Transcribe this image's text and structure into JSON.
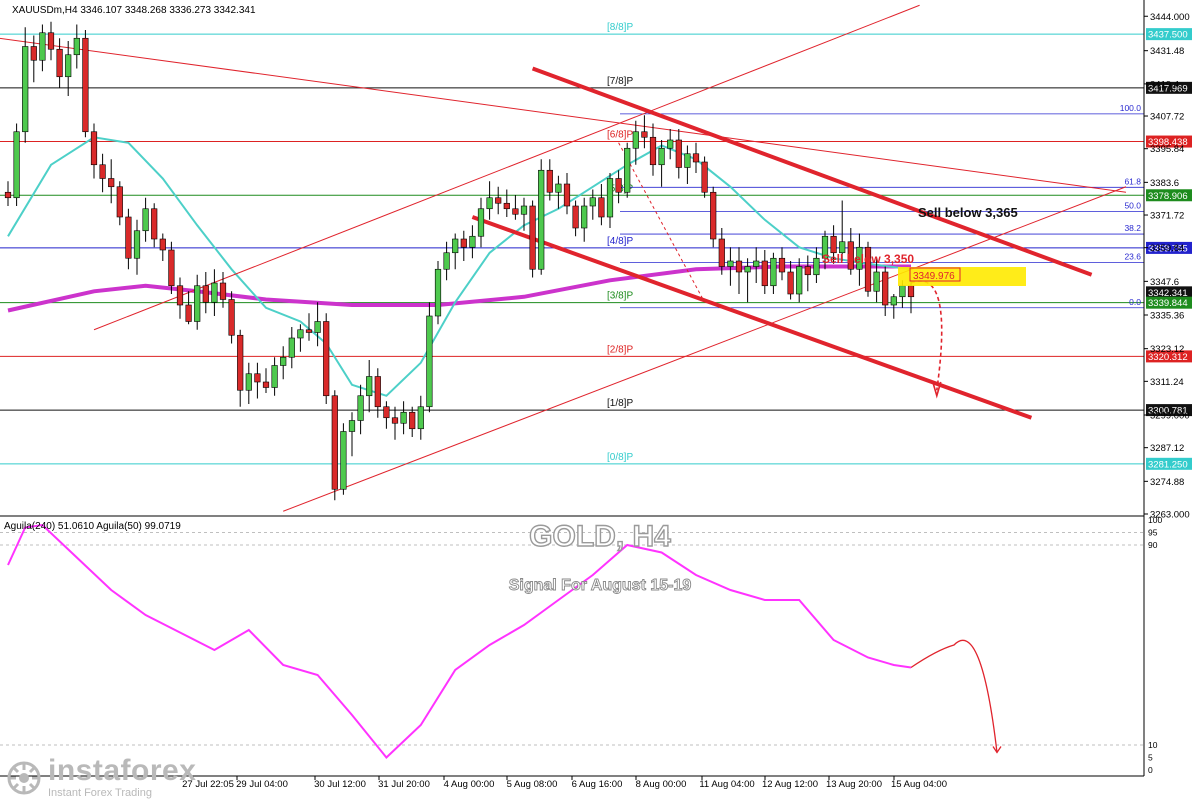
{
  "header": {
    "symbol_text": "XAUUSDm,H4  3346.107 3348.268 3336.273 3342.341",
    "osc_text": "Aguila(240) 51.0610  Aguila(50) 99.0719"
  },
  "overlay": {
    "title": "GOLD, H4",
    "subtitle": "Signal For August 15-19",
    "sell1": "Sell below 3,365",
    "sell2": "Sell below 3,350",
    "price_box": "3349.976"
  },
  "murrey": [
    {
      "name": "[8/8]P",
      "price": 3437.5,
      "color": "#33cccc"
    },
    {
      "name": "[7/8]P",
      "price": 3417.969,
      "color": "#111111"
    },
    {
      "name": "[6/8]P",
      "price": 3398.438,
      "color": "#dd2222"
    },
    {
      "name": "[5/8]P",
      "price": 3378.906,
      "color": "#1e8c1e"
    },
    {
      "name": "[4/8]P",
      "price": 3359.765,
      "color": "#2222cc"
    },
    {
      "name": "[3/8]P",
      "price": 3339.844,
      "color": "#1e8c1e"
    },
    {
      "name": "[2/8]P",
      "price": 3320.312,
      "color": "#dd2222"
    },
    {
      "name": "[1/8]P",
      "price": 3300.781,
      "color": "#111111"
    },
    {
      "name": "[0/8]P",
      "price": 3281.25,
      "color": "#33cccc"
    }
  ],
  "fib": [
    {
      "label": "100.0",
      "price": 3408.5
    },
    {
      "label": "61.8",
      "price": 3381.8
    },
    {
      "label": "50.0",
      "price": 3373.0
    },
    {
      "label": "38.2",
      "price": 3364.8
    },
    {
      "label": "23.6",
      "price": 3354.5
    },
    {
      "label": "0.0",
      "price": 3338.0
    }
  ],
  "price_boxes": [
    {
      "text": "3437.500",
      "price": 3437.5,
      "bg": "#33cccc",
      "fg": "#ffffff"
    },
    {
      "text": "3417.969",
      "price": 3417.969,
      "bg": "#111111",
      "fg": "#ffffff"
    },
    {
      "text": "3398.438",
      "price": 3398.438,
      "bg": "#dd2222",
      "fg": "#ffffff"
    },
    {
      "text": "3378.906",
      "price": 3378.906,
      "bg": "#1e8c1e",
      "fg": "#ffffff"
    },
    {
      "text": "3359.765",
      "price": 3359.765,
      "bg": "#2222cc",
      "fg": "#ffffff"
    },
    {
      "text": "3342.341",
      "price": 3343.6,
      "bg": "#111111",
      "fg": "#ffffff"
    },
    {
      "text": "3339.844",
      "price": 3339.844,
      "bg": "#1e8c1e",
      "fg": "#ffffff"
    },
    {
      "text": "3320.312",
      "price": 3320.312,
      "bg": "#dd2222",
      "fg": "#ffffff"
    },
    {
      "text": "3300.781",
      "price": 3300.781,
      "bg": "#111111",
      "fg": "#ffffff"
    },
    {
      "text": "3281.250",
      "price": 3281.25,
      "bg": "#33cccc",
      "fg": "#ffffff"
    }
  ],
  "chart_data": {
    "type": "candlestick",
    "title": "GOLD, H4",
    "subtitle": "Signal For August 15-19",
    "symbol": "XAUUSDm",
    "timeframe": "H4",
    "ohlc_last": {
      "open": 3346.107,
      "high": 3348.268,
      "low": 3336.273,
      "close": 3342.341
    },
    "y_ticks": [
      3444.0,
      3431.48,
      3419.4,
      3407.72,
      3395.84,
      3383.6,
      3371.72,
      3359.84,
      3347.6,
      3335.36,
      3323.12,
      3311.24,
      3299.0,
      3287.12,
      3274.88,
      3263.0
    ],
    "ylim": [
      3263.0,
      3447.0
    ],
    "x_ticks": [
      "27 Jul 22:05",
      "29 Jul 04:00",
      "30 Jul 12:00",
      "31 Jul 20:00",
      "4 Aug 00:00",
      "5 Aug 08:00",
      "6 Aug 16:00",
      "8 Aug 00:00",
      "11 Aug 04:00",
      "12 Aug 12:00",
      "13 Aug 20:00",
      "15 Aug 04:00"
    ],
    "candles": [
      [
        3380,
        3384,
        3375,
        3378
      ],
      [
        3378,
        3405,
        3375,
        3402
      ],
      [
        3402,
        3440,
        3398,
        3433
      ],
      [
        3433,
        3437,
        3420,
        3428
      ],
      [
        3428,
        3441,
        3424,
        3438
      ],
      [
        3438,
        3442,
        3428,
        3432
      ],
      [
        3432,
        3436,
        3418,
        3422
      ],
      [
        3422,
        3435,
        3415,
        3430
      ],
      [
        3430,
        3441,
        3425,
        3436
      ],
      [
        3436,
        3439,
        3400,
        3402
      ],
      [
        3402,
        3405,
        3385,
        3390
      ],
      [
        3390,
        3394,
        3380,
        3385
      ],
      [
        3385,
        3392,
        3376,
        3382
      ],
      [
        3382,
        3384,
        3368,
        3371
      ],
      [
        3371,
        3374,
        3352,
        3356
      ],
      [
        3356,
        3370,
        3350,
        3366
      ],
      [
        3366,
        3378,
        3362,
        3374
      ],
      [
        3374,
        3376,
        3360,
        3363
      ],
      [
        3363,
        3365,
        3355,
        3359
      ],
      [
        3359,
        3362,
        3343,
        3346
      ],
      [
        3346,
        3349,
        3334,
        3339
      ],
      [
        3339,
        3344,
        3332,
        3333
      ],
      [
        3333,
        3350,
        3330,
        3346
      ],
      [
        3346,
        3351,
        3336,
        3340
      ],
      [
        3340,
        3352,
        3335,
        3347
      ],
      [
        3347,
        3351,
        3338,
        3341
      ],
      [
        3341,
        3344,
        3325,
        3328
      ],
      [
        3328,
        3330,
        3302,
        3308
      ],
      [
        3308,
        3318,
        3303,
        3314
      ],
      [
        3314,
        3318,
        3305,
        3311
      ],
      [
        3311,
        3316,
        3307,
        3309
      ],
      [
        3309,
        3320,
        3306,
        3317
      ],
      [
        3317,
        3324,
        3312,
        3320
      ],
      [
        3320,
        3331,
        3316,
        3327
      ],
      [
        3327,
        3332,
        3322,
        3330
      ],
      [
        3330,
        3336,
        3326,
        3329
      ],
      [
        3329,
        3340,
        3324,
        3333
      ],
      [
        3333,
        3336,
        3303,
        3306
      ],
      [
        3306,
        3308,
        3268,
        3272
      ],
      [
        3272,
        3296,
        3270,
        3293
      ],
      [
        3293,
        3300,
        3284,
        3297
      ],
      [
        3297,
        3310,
        3292,
        3306
      ],
      [
        3306,
        3319,
        3300,
        3313
      ],
      [
        3313,
        3316,
        3298,
        3302
      ],
      [
        3302,
        3304,
        3294,
        3298
      ],
      [
        3298,
        3302,
        3290,
        3296
      ],
      [
        3296,
        3304,
        3292,
        3300
      ],
      [
        3300,
        3302,
        3291,
        3294
      ],
      [
        3294,
        3306,
        3290,
        3302
      ],
      [
        3302,
        3340,
        3300,
        3335
      ],
      [
        3335,
        3355,
        3332,
        3352
      ],
      [
        3352,
        3362,
        3348,
        3358
      ],
      [
        3358,
        3365,
        3352,
        3363
      ],
      [
        3363,
        3366,
        3355,
        3360
      ],
      [
        3360,
        3368,
        3356,
        3364
      ],
      [
        3364,
        3378,
        3360,
        3374
      ],
      [
        3374,
        3384,
        3370,
        3378
      ],
      [
        3378,
        3382,
        3372,
        3376
      ],
      [
        3376,
        3381,
        3371,
        3374
      ],
      [
        3374,
        3379,
        3370,
        3372
      ],
      [
        3372,
        3378,
        3366,
        3375
      ],
      [
        3375,
        3377,
        3349,
        3352
      ],
      [
        3352,
        3392,
        3350,
        3388
      ],
      [
        3388,
        3392,
        3377,
        3380
      ],
      [
        3380,
        3386,
        3374,
        3383
      ],
      [
        3383,
        3387,
        3372,
        3375
      ],
      [
        3375,
        3377,
        3364,
        3367
      ],
      [
        3367,
        3378,
        3362,
        3375
      ],
      [
        3375,
        3381,
        3370,
        3378
      ],
      [
        3378,
        3383,
        3368,
        3371
      ],
      [
        3371,
        3387,
        3367,
        3385
      ],
      [
        3385,
        3388,
        3376,
        3380
      ],
      [
        3380,
        3398,
        3378,
        3396
      ],
      [
        3396,
        3406,
        3390,
        3402
      ],
      [
        3402,
        3408,
        3396,
        3400
      ],
      [
        3400,
        3405,
        3386,
        3390
      ],
      [
        3390,
        3399,
        3382,
        3396
      ],
      [
        3396,
        3403,
        3392,
        3399
      ],
      [
        3399,
        3403,
        3385,
        3389
      ],
      [
        3389,
        3397,
        3383,
        3394
      ],
      [
        3394,
        3398,
        3387,
        3391
      ],
      [
        3391,
        3393,
        3378,
        3380
      ],
      [
        3380,
        3382,
        3360,
        3363
      ],
      [
        3363,
        3367,
        3350,
        3353
      ],
      [
        3353,
        3360,
        3346,
        3355
      ],
      [
        3355,
        3360,
        3343,
        3351
      ],
      [
        3351,
        3356,
        3340,
        3353
      ],
      [
        3353,
        3360,
        3347,
        3355
      ],
      [
        3355,
        3359,
        3343,
        3346
      ],
      [
        3346,
        3358,
        3343,
        3356
      ],
      [
        3356,
        3360,
        3348,
        3351
      ],
      [
        3351,
        3355,
        3341,
        3343
      ],
      [
        3343,
        3356,
        3340,
        3353
      ],
      [
        3353,
        3357,
        3344,
        3350
      ],
      [
        3350,
        3360,
        3347,
        3356
      ],
      [
        3356,
        3366,
        3352,
        3364
      ],
      [
        3364,
        3368,
        3354,
        3358
      ],
      [
        3358,
        3377,
        3355,
        3362
      ],
      [
        3362,
        3367,
        3350,
        3352
      ],
      [
        3352,
        3365,
        3346,
        3360
      ],
      [
        3360,
        3362,
        3342,
        3344
      ],
      [
        3344,
        3356,
        3340,
        3351
      ],
      [
        3351,
        3353,
        3335,
        3339
      ],
      [
        3339,
        3343,
        3334,
        3342
      ],
      [
        3342,
        3348,
        3338,
        3346
      ],
      [
        3346,
        3348,
        3336,
        3342
      ]
    ],
    "ma_fast": [
      [
        0,
        3364
      ],
      [
        5,
        3390
      ],
      [
        10,
        3400
      ],
      [
        14,
        3398
      ],
      [
        18,
        3385
      ],
      [
        22,
        3368
      ],
      [
        26,
        3352
      ],
      [
        30,
        3338
      ],
      [
        34,
        3333
      ],
      [
        37,
        3325
      ],
      [
        40,
        3310
      ],
      [
        44,
        3306
      ],
      [
        48,
        3318
      ],
      [
        52,
        3340
      ],
      [
        56,
        3358
      ],
      [
        60,
        3368
      ],
      [
        64,
        3374
      ],
      [
        68,
        3382
      ],
      [
        72,
        3390
      ],
      [
        76,
        3397
      ],
      [
        80,
        3392
      ],
      [
        84,
        3382
      ],
      [
        88,
        3370
      ],
      [
        92,
        3360
      ],
      [
        96,
        3356
      ],
      [
        100,
        3354
      ],
      [
        105,
        3352
      ]
    ],
    "ma_slow": [
      [
        0,
        3337
      ],
      [
        10,
        3344
      ],
      [
        16,
        3346
      ],
      [
        22,
        3344
      ],
      [
        30,
        3341
      ],
      [
        40,
        3339
      ],
      [
        50,
        3339
      ],
      [
        60,
        3342
      ],
      [
        70,
        3348
      ],
      [
        80,
        3352
      ],
      [
        90,
        3353
      ],
      [
        100,
        3353
      ],
      [
        105,
        3353
      ]
    ],
    "oscillator": {
      "name": "Aguila(240)",
      "value": 51.061,
      "ylim": [
        0,
        100
      ],
      "levels": [
        10,
        90,
        95
      ],
      "points": [
        [
          0,
          82
        ],
        [
          2,
          97
        ],
        [
          4,
          98
        ],
        [
          8,
          85
        ],
        [
          12,
          72
        ],
        [
          16,
          62
        ],
        [
          20,
          55
        ],
        [
          24,
          48
        ],
        [
          28,
          56
        ],
        [
          32,
          42
        ],
        [
          36,
          38
        ],
        [
          40,
          22
        ],
        [
          44,
          5
        ],
        [
          48,
          18
        ],
        [
          52,
          40
        ],
        [
          56,
          50
        ],
        [
          60,
          58
        ],
        [
          64,
          68
        ],
        [
          68,
          78
        ],
        [
          72,
          90
        ],
        [
          76,
          87
        ],
        [
          80,
          78
        ],
        [
          84,
          72
        ],
        [
          88,
          68
        ],
        [
          92,
          68
        ],
        [
          96,
          52
        ],
        [
          100,
          45
        ],
        [
          103,
          42
        ],
        [
          105,
          41
        ]
      ],
      "projection": [
        [
          105,
          41
        ],
        [
          108,
          48
        ],
        [
          110,
          50
        ],
        [
          112,
          41
        ],
        [
          115,
          7
        ]
      ]
    }
  }
}
